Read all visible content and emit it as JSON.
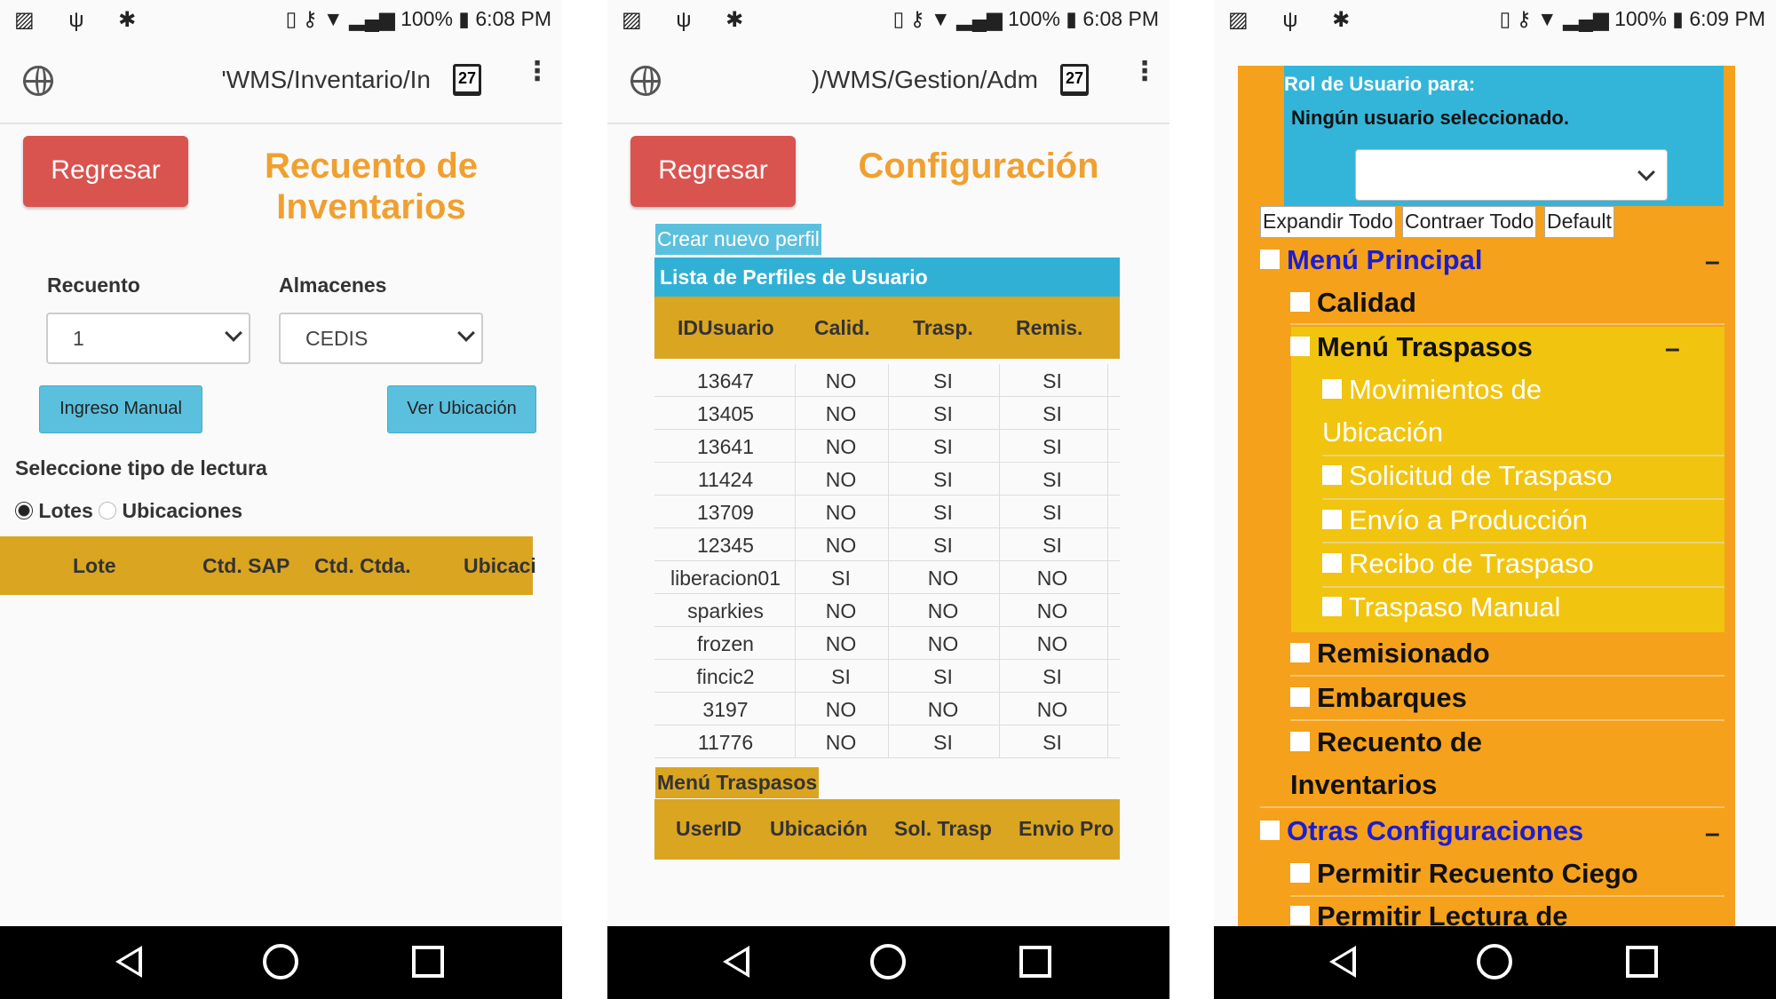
{
  "status": {
    "left_icons": "▨ ψ ✱",
    "panel1_right": "▯ ⚷ ▼ ▂▄▆ 100% ▮ 6:08 PM",
    "panel2_right": "▯ ⚷ ▼ ▂▄▆ 100% ▮ 6:08 PM",
    "panel3_right": "▯ ⚷ ▼ ▂▄▆ 100% ▮ 6:09 PM"
  },
  "browser": {
    "panel1_url": "'WMS/Inventario/In",
    "panel2_url": ")/WMS/Gestion/Adm",
    "tab_count": "27",
    "menu_icon": "⋮"
  },
  "panel1": {
    "back_label": "Regresar",
    "title": "Recuento de Inventarios",
    "recuento_label": "Recuento",
    "recuento_value": "1",
    "almacenes_label": "Almacenes",
    "almacenes_value": "CEDIS",
    "ingreso_label": "Ingreso Manual",
    "ver_label": "Ver Ubicación",
    "lectura_label": "Seleccione tipo de lectura",
    "radio_lotes": "Lotes",
    "radio_ubicaciones": "Ubicaciones",
    "headers": [
      "Lote",
      "Ctd. SAP",
      "Ctd. Ctda.",
      "Ubicaci"
    ]
  },
  "panel2": {
    "back_label": "Regresar",
    "title": "Configuración",
    "crear_label": "Crear nuevo perfil",
    "lista_label": "Lista de Perfiles de Usuario",
    "headers": [
      "IDUsuario",
      "Calid.",
      "Trasp.",
      "Remis."
    ],
    "rows": [
      [
        "13647",
        "NO",
        "SI",
        "SI"
      ],
      [
        "13405",
        "NO",
        "SI",
        "SI"
      ],
      [
        "13641",
        "NO",
        "SI",
        "SI"
      ],
      [
        "11424",
        "NO",
        "SI",
        "SI"
      ],
      [
        "13709",
        "NO",
        "SI",
        "SI"
      ],
      [
        "12345",
        "NO",
        "SI",
        "SI"
      ],
      [
        "liberacion01",
        "SI",
        "NO",
        "NO"
      ],
      [
        "sparkies",
        "NO",
        "NO",
        "NO"
      ],
      [
        "frozen",
        "NO",
        "NO",
        "NO"
      ],
      [
        "fincic2",
        "SI",
        "SI",
        "SI"
      ],
      [
        "3197",
        "NO",
        "NO",
        "NO"
      ],
      [
        "11776",
        "NO",
        "SI",
        "SI"
      ]
    ],
    "menu_traspasos": "Menú Traspasos",
    "headers2": [
      "UserID",
      "Ubicación",
      "Sol. Trasp",
      "Envio Pro"
    ]
  },
  "panel3": {
    "rol_label": "Rol de Usuario para:",
    "no_user": "Ningún usuario seleccionado.",
    "expandir": "Expandir Todo",
    "contraer": "Contraer Todo",
    "default": "Default",
    "menu_principal": "Menú Principal",
    "calidad": "Calidad",
    "menu_traspasos": "Menú Traspasos",
    "mov1": "Movimientos de",
    "mov2": "Ubicación",
    "solicitud": "Solicitud de Traspaso",
    "envio": "Envío a Producción",
    "recibo": "Recibo de Traspaso",
    "manual": "Traspaso Manual",
    "remisionado": "Remisionado",
    "embarques": "Embarques",
    "recuento1": "Recuento de",
    "recuento2": "Inventarios",
    "otras": "Otras Configuraciones",
    "ciego": "Permitir Recuento Ciego",
    "lectura": "Permitir Lectura de",
    "collapse": "–"
  }
}
